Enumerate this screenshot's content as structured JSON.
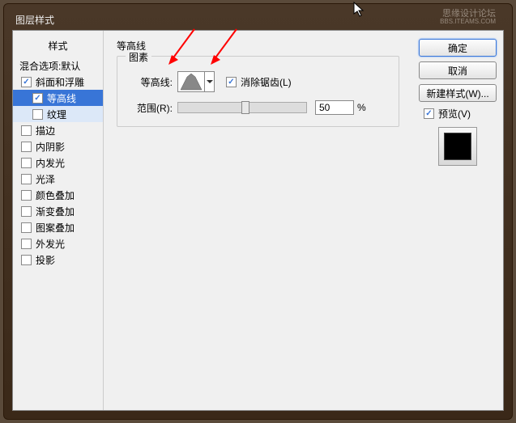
{
  "title": "图层样式",
  "watermark": {
    "line1": "思缘设计论坛",
    "line2": "BBS.ITEAMS.COM"
  },
  "sidebar": {
    "header": "样式",
    "blend": "混合选项:默认",
    "items": [
      {
        "label": "斜面和浮雕",
        "checked": true,
        "selected": false
      },
      {
        "label": "等高线",
        "checked": true,
        "selected": true,
        "sub": true
      },
      {
        "label": "纹理",
        "checked": false,
        "selected": false,
        "sub": true,
        "hl": true
      },
      {
        "label": "描边",
        "checked": false
      },
      {
        "label": "内阴影",
        "checked": false
      },
      {
        "label": "内发光",
        "checked": false
      },
      {
        "label": "光泽",
        "checked": false
      },
      {
        "label": "颜色叠加",
        "checked": false
      },
      {
        "label": "渐变叠加",
        "checked": false
      },
      {
        "label": "图案叠加",
        "checked": false
      },
      {
        "label": "外发光",
        "checked": false
      },
      {
        "label": "投影",
        "checked": false
      }
    ]
  },
  "main": {
    "section_title": "等高线",
    "group_legend": "图素",
    "contour_label": "等高线:",
    "anti_alias": "消除锯齿(L)",
    "anti_alias_checked": true,
    "range_label": "范围(R):",
    "range_value": "50",
    "range_unit": "%"
  },
  "buttons": {
    "ok": "确定",
    "cancel": "取消",
    "new_style": "新建样式(W)...",
    "preview": "预览(V)",
    "preview_checked": true
  }
}
